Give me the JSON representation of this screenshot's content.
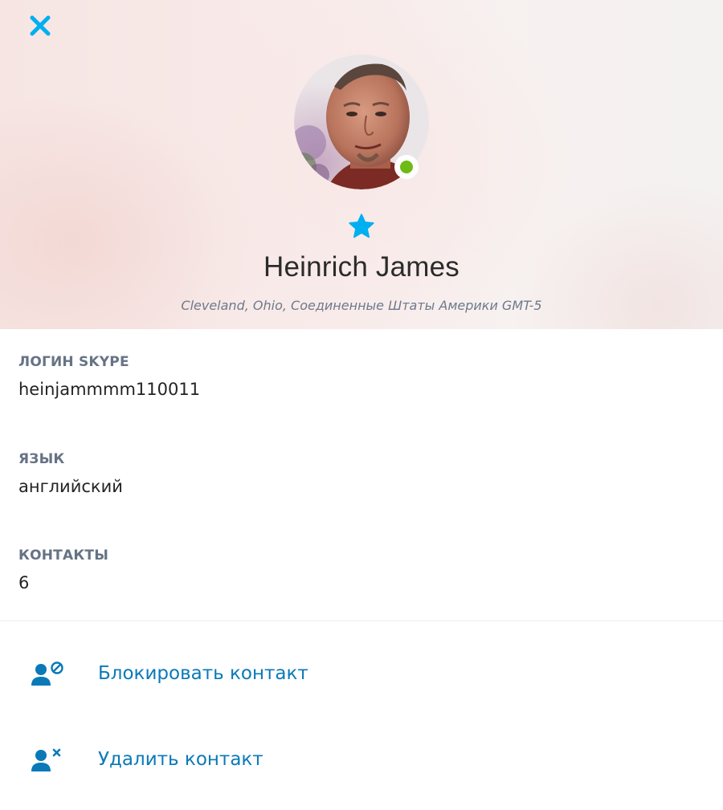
{
  "colors": {
    "accent": "#00aff0",
    "link": "#0a79b8",
    "online": "#6dbb14",
    "label": "#667385"
  },
  "header": {
    "close_icon": "close-icon",
    "avatar_icon": "profile-photo",
    "status": "online",
    "favorite_icon": "star-icon",
    "display_name": "Heinrich James",
    "location": "Cleveland, Ohio, Соединенные Штаты Америки GMT-5"
  },
  "fields": [
    {
      "label": "ЛОГИН SKYPE",
      "value": "heinjammmm110011"
    },
    {
      "label": "ЯЗЫК",
      "value": "английский"
    },
    {
      "label": "КОНТАКТЫ",
      "value": "6"
    }
  ],
  "actions": [
    {
      "icon": "block-contact-icon",
      "label": "Блокировать контакт"
    },
    {
      "icon": "remove-contact-icon",
      "label": "Удалить контакт"
    }
  ]
}
